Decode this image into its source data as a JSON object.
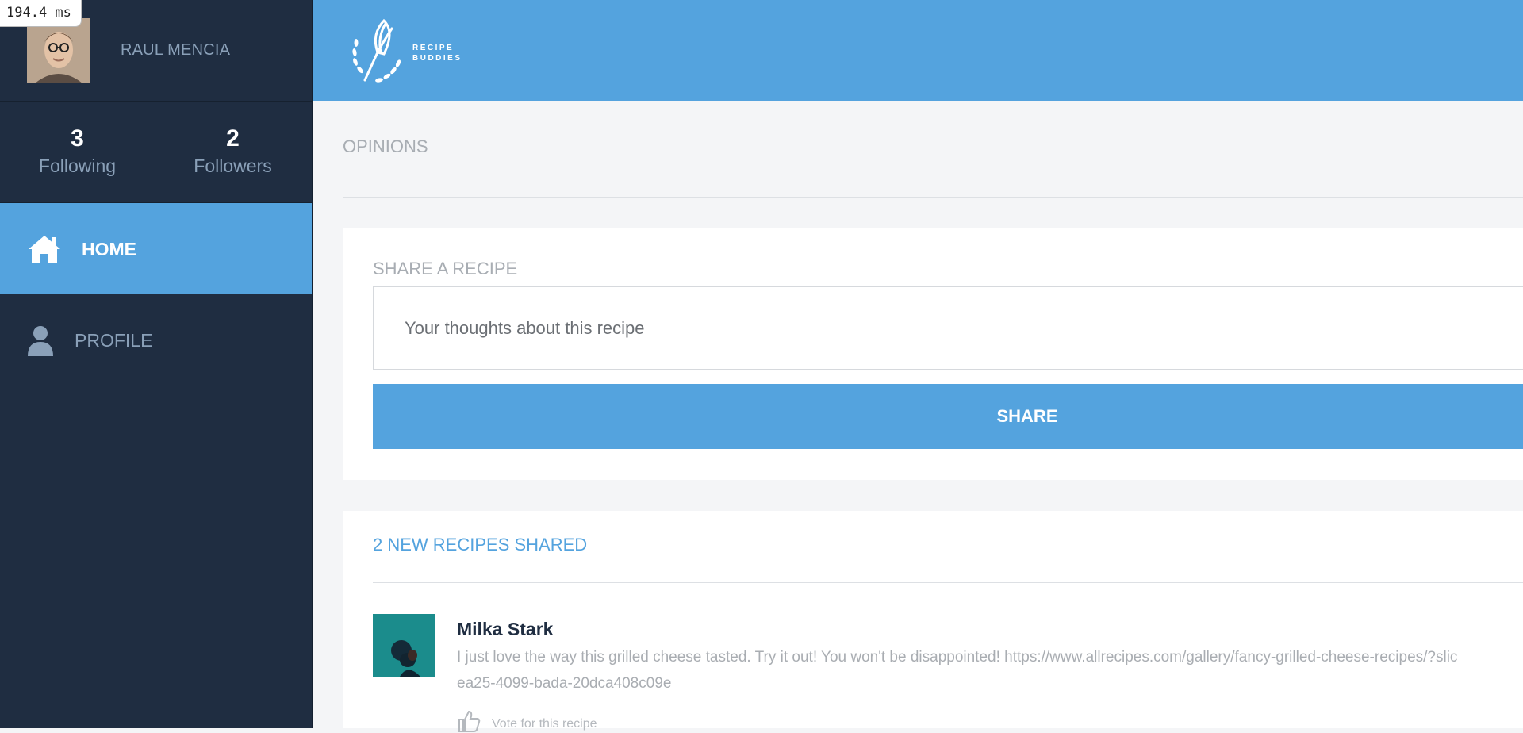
{
  "perf": {
    "timing": "194.4 ms"
  },
  "user": {
    "name": "RAUL MENCIA"
  },
  "stats": {
    "following": {
      "count": "3",
      "label": "Following"
    },
    "followers": {
      "count": "2",
      "label": "Followers"
    }
  },
  "nav": {
    "home": {
      "label": "HOME",
      "icon": "home-icon"
    },
    "profile": {
      "label": "PROFILE",
      "icon": "user-icon"
    }
  },
  "brand": {
    "line1": "RECIPE",
    "line2": "BUDDIES"
  },
  "section": {
    "title": "OPINIONS"
  },
  "share": {
    "heading": "SHARE A RECIPE",
    "placeholder": "Your thoughts about this recipe",
    "button_label": "SHARE"
  },
  "feed": {
    "heading": "2 NEW RECIPES SHARED",
    "posts": [
      {
        "author": "Milka Stark",
        "text_line1": "I just love the way this grilled cheese tasted. Try it out! You won't be disappointed! https://www.allrecipes.com/gallery/fancy-grilled-cheese-recipes/?slic",
        "text_line2": "ea25-4099-bada-20dca408c09e",
        "vote_label": "Vote for this recipe"
      }
    ]
  },
  "colors": {
    "accent": "#54a3de",
    "sidebar": "#1f2d41",
    "background": "#f4f5f7"
  }
}
